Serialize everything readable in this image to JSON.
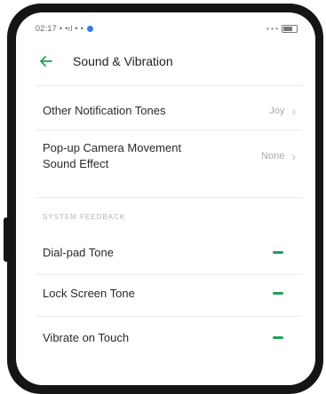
{
  "status_bar": {
    "time_and_signal": "02:17 • •ıl • •",
    "right": "• • •"
  },
  "header": {
    "title": "Sound & Vibration",
    "back_icon": "back-arrow-icon"
  },
  "rows": [
    {
      "label": "Other Notification Tones",
      "value": "Joy"
    },
    {
      "label": "Pop-up Camera Movement Sound Effect",
      "value": "None"
    }
  ],
  "section": {
    "label": "SYSTEM FEEDBACK"
  },
  "toggles": [
    {
      "label": "Dial-pad Tone",
      "on": true
    },
    {
      "label": "Lock Screen Tone",
      "on": true
    },
    {
      "label": "Vibrate on Touch",
      "on": true
    }
  ],
  "colors": {
    "accent": "#1fa05a",
    "frame": "#151515"
  }
}
